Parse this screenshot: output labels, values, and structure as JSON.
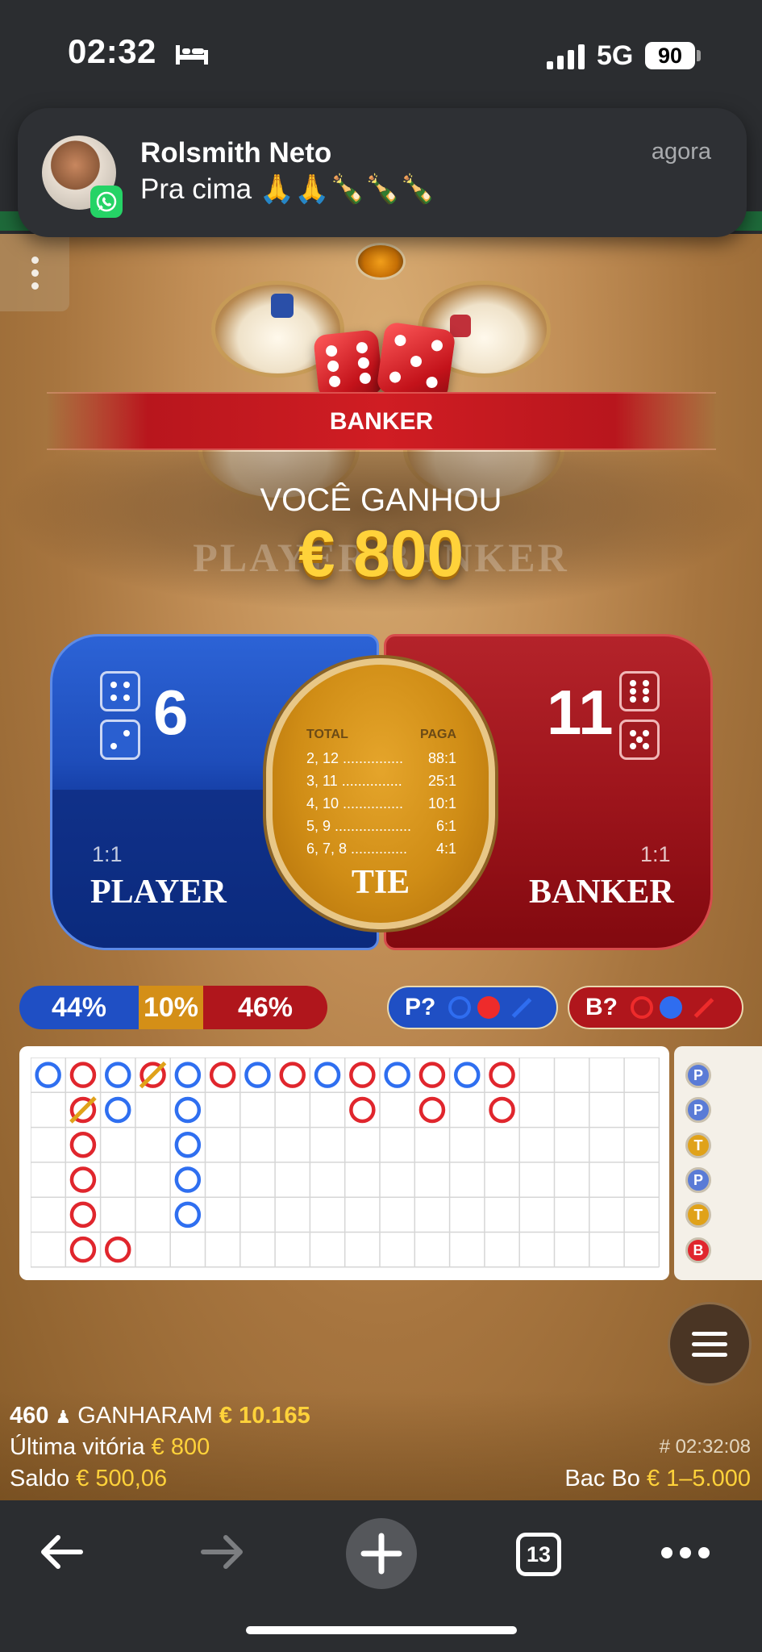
{
  "status_bar": {
    "time": "02:32",
    "network": "5G",
    "battery": "90"
  },
  "notification": {
    "sender": "Rolsmith Neto",
    "message": "Pra cima 🙏🙏🍾🍾🍾",
    "time": "agora"
  },
  "game": {
    "result_banner": "BANKER",
    "win_label": "VOCÊ GANHOU",
    "win_amount": "€ 800",
    "ghost_text": "PLAYER BANKER",
    "player": {
      "score": "6",
      "label": "PLAYER",
      "ratio": "1:1",
      "dice": [
        4,
        2
      ]
    },
    "banker": {
      "score": "11",
      "label": "BANKER",
      "ratio": "1:1",
      "dice": [
        6,
        5
      ]
    },
    "tie": {
      "label": "TIE",
      "header_total": "TOTAL",
      "header_pays": "PAGA",
      "rows": [
        {
          "total": "2, 12 ...............",
          "pays": "88:1"
        },
        {
          "total": "3, 11 ...............",
          "pays": "25:1"
        },
        {
          "total": "4, 10 ...............",
          "pays": "10:1"
        },
        {
          "total": "5, 9 ...................",
          "pays": "6:1"
        },
        {
          "total": "6, 7, 8 ..............",
          "pays": "4:1"
        }
      ]
    },
    "stats": {
      "player_pct": "44%",
      "tie_pct": "10%",
      "banker_pct": "46%"
    },
    "predictions": {
      "player": "P?",
      "banker": "B?"
    },
    "bead_road": [
      "P",
      "P",
      "T",
      "P",
      "T",
      "B"
    ],
    "colors": {
      "player": "#1f4fc4",
      "banker": "#b0161c",
      "tie": "#d48f17",
      "win_gold": "#ffd23a"
    }
  },
  "footer": {
    "players_count": "460",
    "players_won_label": "GANHARAM",
    "players_won_amount": "€ 10.165",
    "last_win_label": "Última vitória",
    "last_win_amount": "€ 800",
    "balance_label": "Saldo",
    "balance_amount": "€ 500,06",
    "round_id": "# 02:32:08",
    "game_name": "Bac Bo",
    "limits": "€ 1–5.000"
  },
  "browser": {
    "tab_count": "13"
  },
  "icons": [
    "bed-icon",
    "signal-icon",
    "battery-icon",
    "whatsapp-icon",
    "more-vertical-icon",
    "menu-icon",
    "back-arrow-icon",
    "forward-arrow-icon",
    "plus-icon",
    "tabs-icon",
    "more-horizontal-icon"
  ]
}
